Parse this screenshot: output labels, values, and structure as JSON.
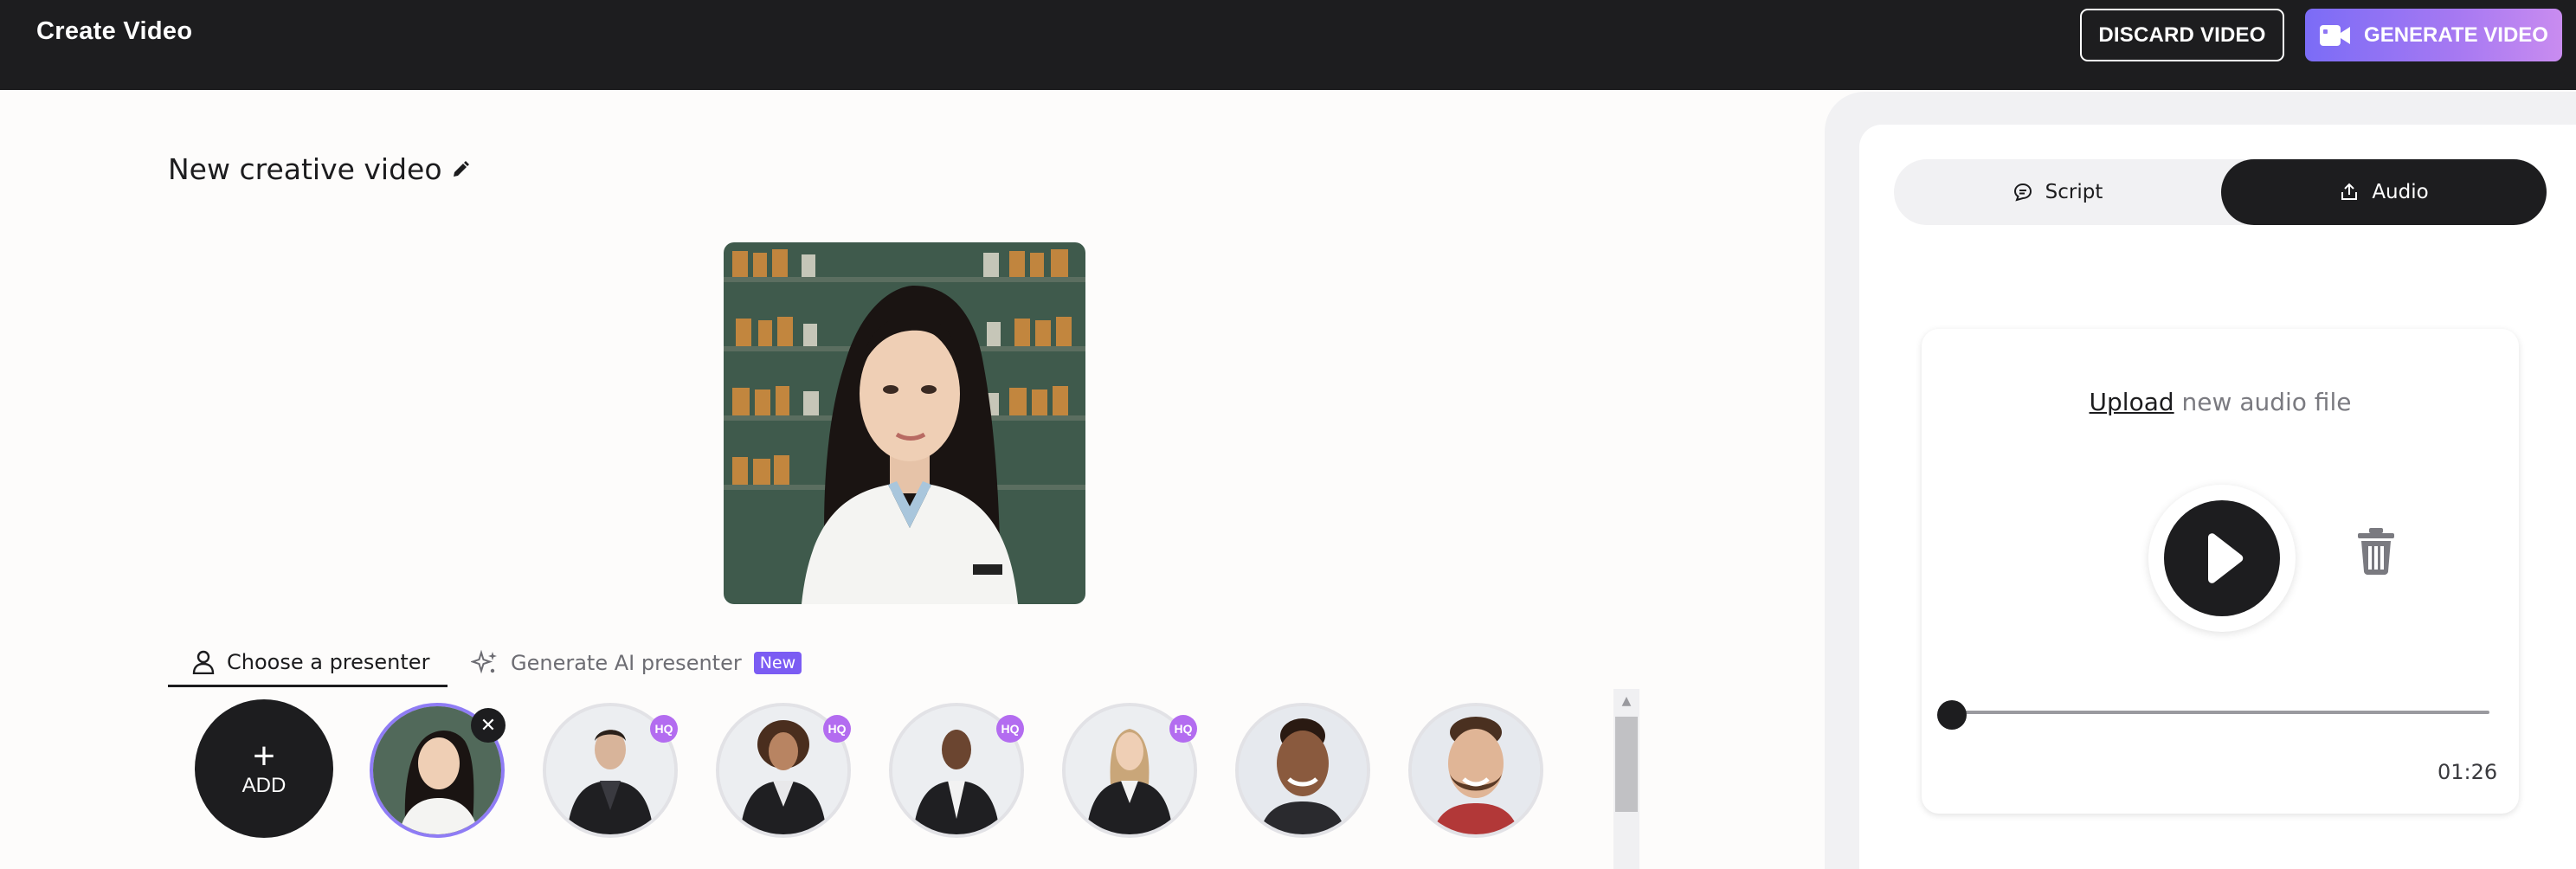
{
  "header": {
    "title": "Create Video",
    "discard_label": "DISCARD VIDEO",
    "generate_label": "GENERATE VIDEO"
  },
  "editor": {
    "video_title": "New creative video"
  },
  "presenter_tabs": {
    "choose_label": "Choose a presenter",
    "generate_label": "Generate AI presenter",
    "new_badge": "New"
  },
  "presenters": {
    "add_label": "ADD",
    "hq_badge": "HQ",
    "items": [
      {
        "name": "presenter-1",
        "selected": true,
        "hq": false
      },
      {
        "name": "presenter-2",
        "selected": false,
        "hq": true
      },
      {
        "name": "presenter-3",
        "selected": false,
        "hq": true
      },
      {
        "name": "presenter-4",
        "selected": false,
        "hq": true
      },
      {
        "name": "presenter-5",
        "selected": false,
        "hq": true
      },
      {
        "name": "presenter-6",
        "selected": false,
        "hq": false
      },
      {
        "name": "presenter-7",
        "selected": false,
        "hq": false
      }
    ]
  },
  "panel": {
    "script_tab": "Script",
    "audio_tab": "Audio",
    "active_tab": "Audio",
    "upload_link": "Upload",
    "upload_rest": "new audio file",
    "duration": "01:26",
    "playback_progress": 0
  },
  "colors": {
    "topbar": "#1d1d1f",
    "accent": "#7b5cf3",
    "hq_badge": "#b36cf0"
  }
}
